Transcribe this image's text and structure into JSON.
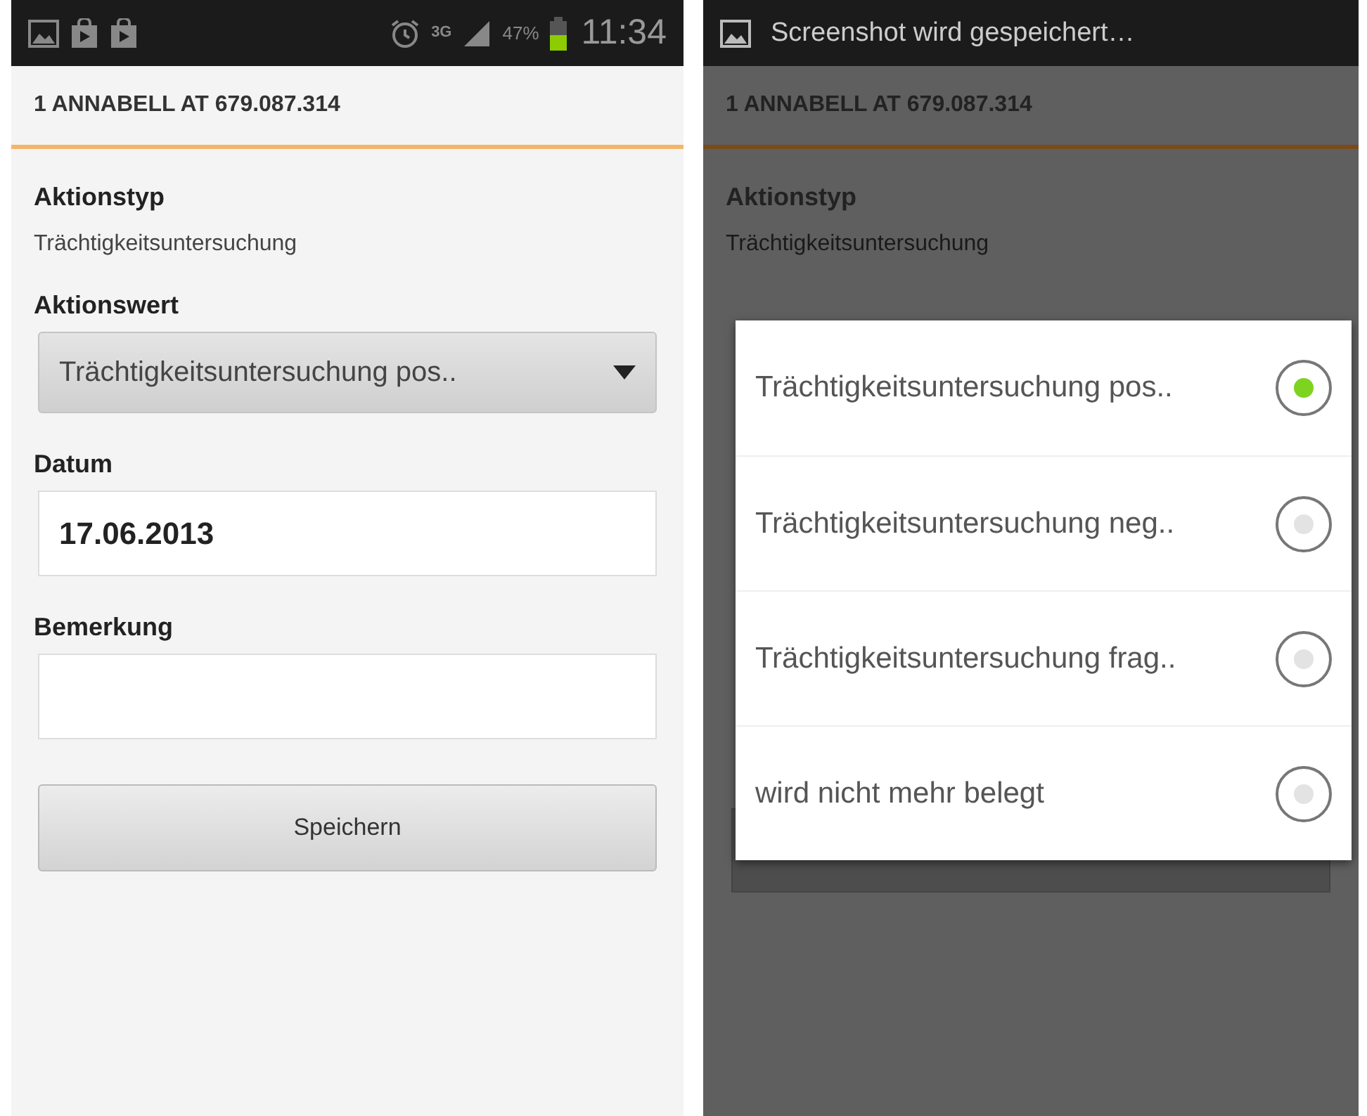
{
  "left_screen": {
    "status_bar": {
      "network": "3G",
      "battery_percent": "47%",
      "time": "11:34"
    },
    "header": "1 ANNABELL  AT 679.087.314",
    "fields": [
      {
        "kind": "static",
        "label": "Aktionstyp",
        "value": "Trächtigkeitsuntersuchung"
      },
      {
        "kind": "select",
        "label": "Aktionswert",
        "value": "Trächtigkeitsuntersuchung pos.."
      },
      {
        "kind": "input",
        "label": "Datum",
        "value": "17.06.2013"
      },
      {
        "kind": "input",
        "label": "Bemerkung"
      }
    ],
    "save_button": "Speichern"
  },
  "right_screen": {
    "status_bar": {
      "notification": "Screenshot wird gespeichert…"
    },
    "header": "1 ANNABELL  AT 679.087.314",
    "fields": [
      {
        "kind": "static",
        "label": "Aktionstyp",
        "value": "Trächtigkeitsuntersuchung"
      }
    ],
    "dialog": {
      "options": [
        {
          "label": "Trächtigkeitsuntersuchung pos..",
          "selected": true
        },
        {
          "label": "Trächtigkeitsuntersuchung neg..",
          "selected": false
        },
        {
          "label": "Trächtigkeitsuntersuchung frag..",
          "selected": false
        },
        {
          "label": "wird nicht mehr belegt",
          "selected": false
        }
      ]
    }
  }
}
